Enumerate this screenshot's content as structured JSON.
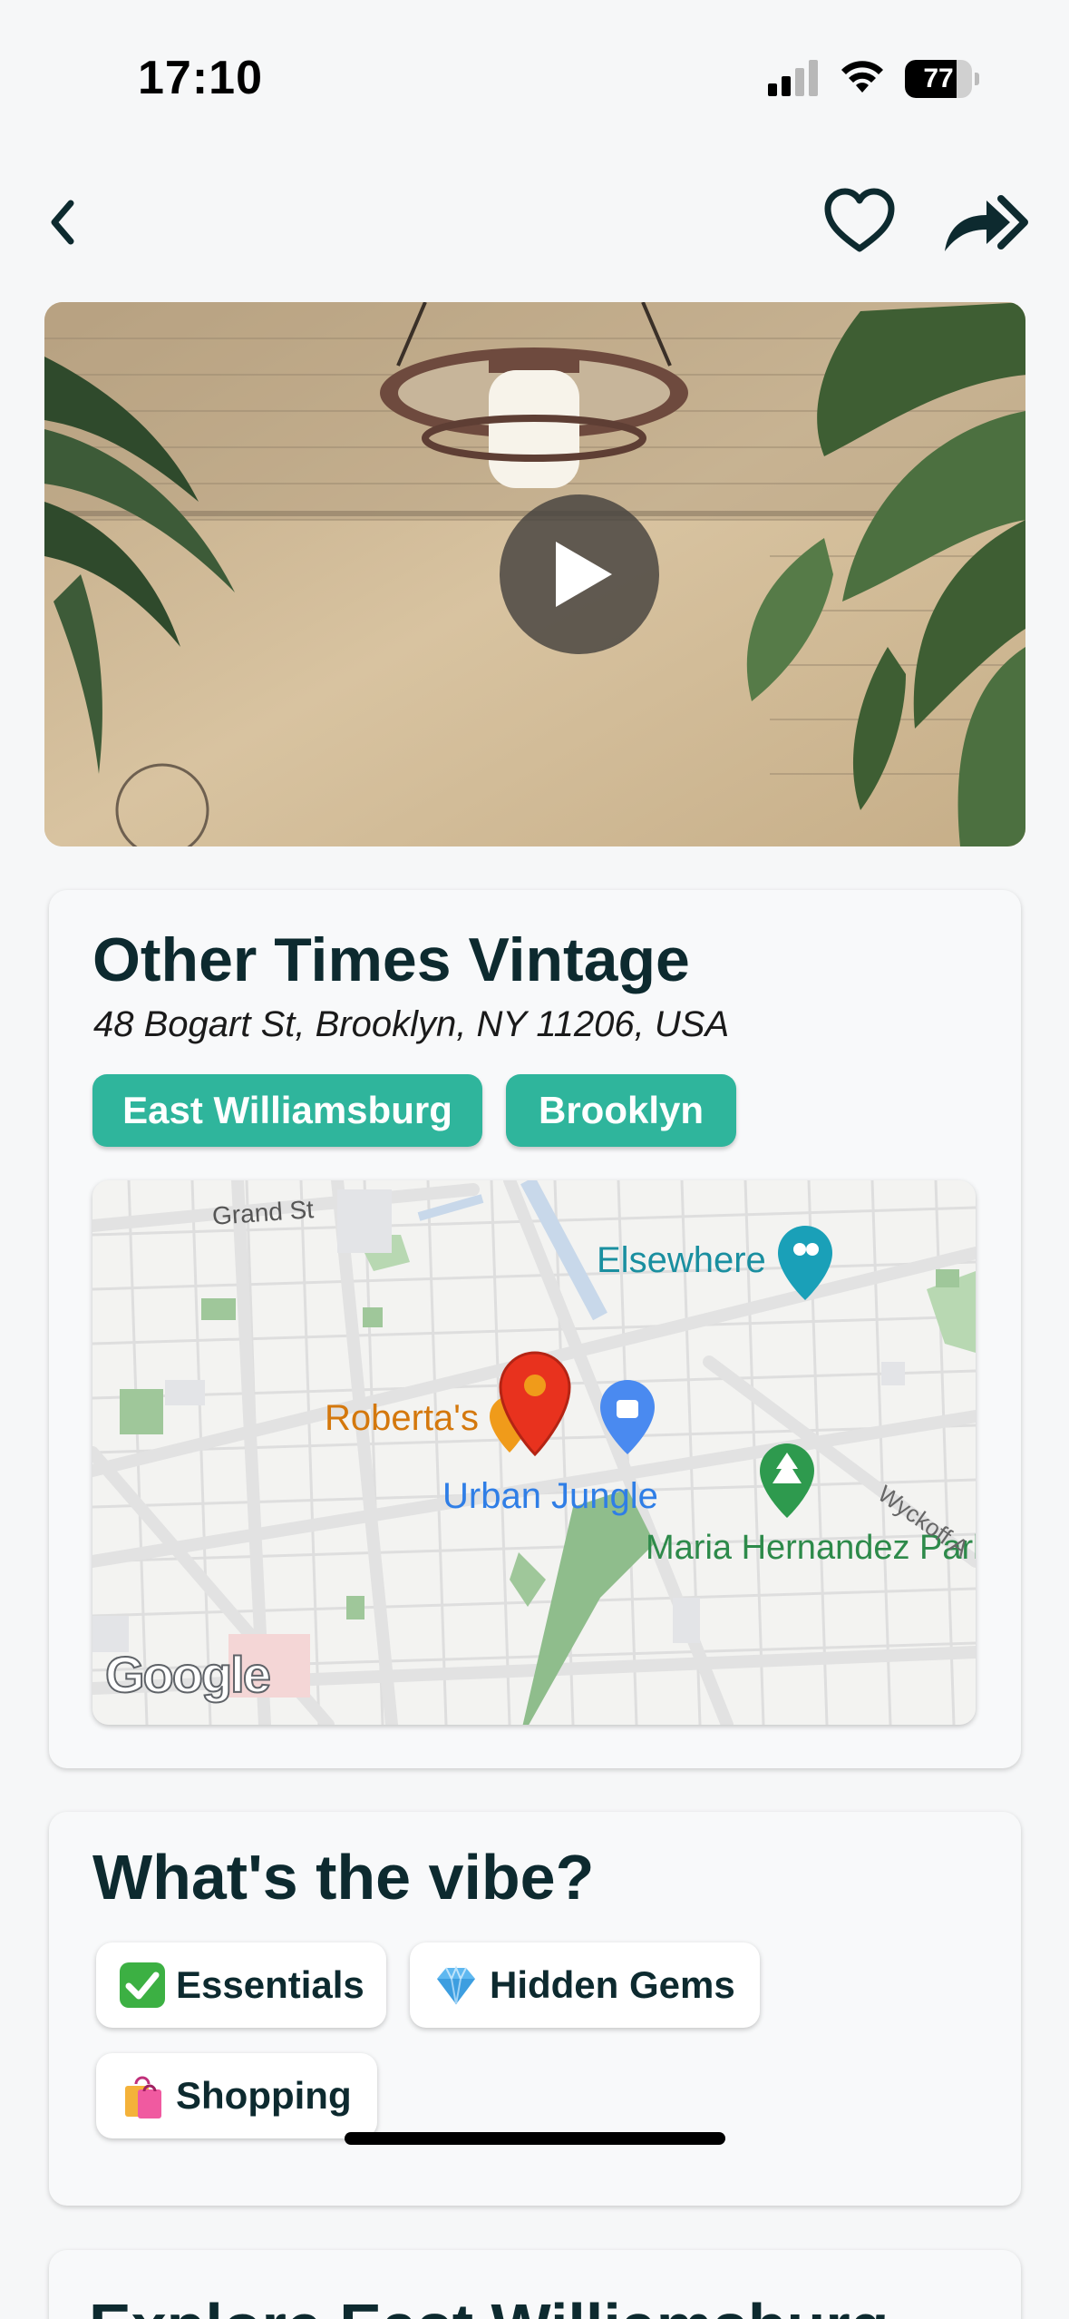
{
  "status_bar": {
    "time": "17:10",
    "battery_level": "77",
    "battery_fraction": 0.77,
    "signal_icon": "cellular-signal-icon",
    "wifi_icon": "wifi-icon"
  },
  "nav": {
    "back_icon": "chevron-left-icon",
    "favorite_icon": "heart-outline-icon",
    "share_icon": "share-forward-icon"
  },
  "video": {
    "play_icon": "play-icon"
  },
  "place": {
    "name": "Other Times Vintage",
    "address": "48 Bogart St, Brooklyn, NY 11206, USA",
    "tags": [
      "East Williamsburg",
      "Brooklyn"
    ]
  },
  "map": {
    "labels": {
      "street_grand": "Grand St",
      "elsewhere": "Elsewhere",
      "robertas": "Roberta's",
      "urban_jungle": "Urban Jungle",
      "maria_park": "Maria Hernandez Park",
      "wyckoff": "Wyckoff A",
      "google": "Google"
    }
  },
  "vibe": {
    "title": "What's the vibe?",
    "chips": [
      {
        "label": "Essentials",
        "icon": "check-mark-button-emoji"
      },
      {
        "label": "Hidden Gems",
        "icon": "gem-stone-emoji"
      },
      {
        "label": "Shopping",
        "icon": "shopping-bags-emoji"
      }
    ]
  },
  "explore": {
    "title": "Explore East Williamsburg"
  },
  "colors": {
    "accent_teal": "#2fb59c",
    "text_dark": "#0d2a2f",
    "background": "#f6f7f8"
  }
}
